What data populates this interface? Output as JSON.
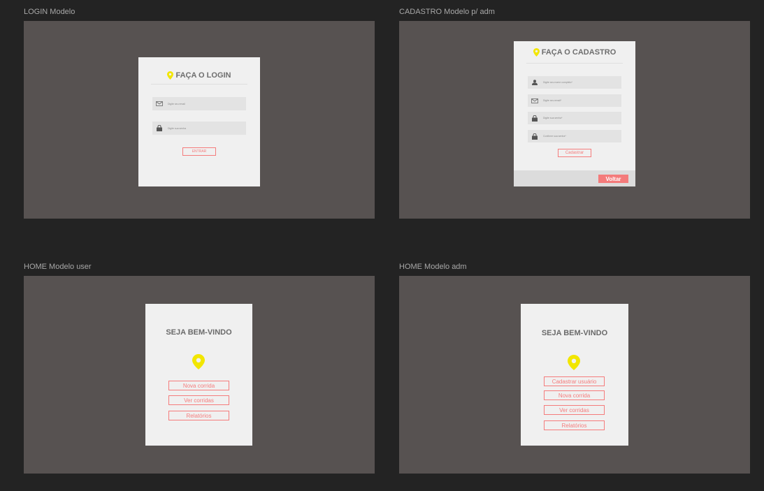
{
  "frames": {
    "login": {
      "label": "LOGIN Modelo",
      "title": "FAÇA O LOGIN",
      "email_placeholder": "Digite seu email",
      "password_placeholder": "Digite sua senha",
      "submit_label": "ENTRAR"
    },
    "register": {
      "label": "CADASTRO Modelo p/ adm",
      "title": "FAÇA O CADASTRO",
      "name_placeholder": "Digite seu nome completo*",
      "email_placeholder": "Digite seu email*",
      "password_placeholder": "Digite sua senha*",
      "confirm_placeholder": "Confirme sua senha*",
      "submit_label": "Cadastrar",
      "back_label": "Voltar"
    },
    "home_user": {
      "label": "HOME Modelo user",
      "welcome": "SEJA BEM-VINDO",
      "buttons": [
        "Nova corrida",
        "Ver corridas",
        "Relatórios"
      ]
    },
    "home_adm": {
      "label": "HOME Modelo adm",
      "welcome": "SEJA BEM-VINDO",
      "buttons": [
        "Cadastrar usuário",
        "Nova corrida",
        "Ver corridas",
        "Relatórios"
      ]
    }
  },
  "colors": {
    "canvas": "#232323",
    "frame": "#575251",
    "card": "#f0f0f0",
    "accent_pin": "#f2e600",
    "accent_button": "#f57c7c"
  },
  "icons": {
    "title_pin": "map-pin-icon",
    "email": "envelope-icon",
    "password": "lock-icon",
    "user": "user-icon"
  }
}
